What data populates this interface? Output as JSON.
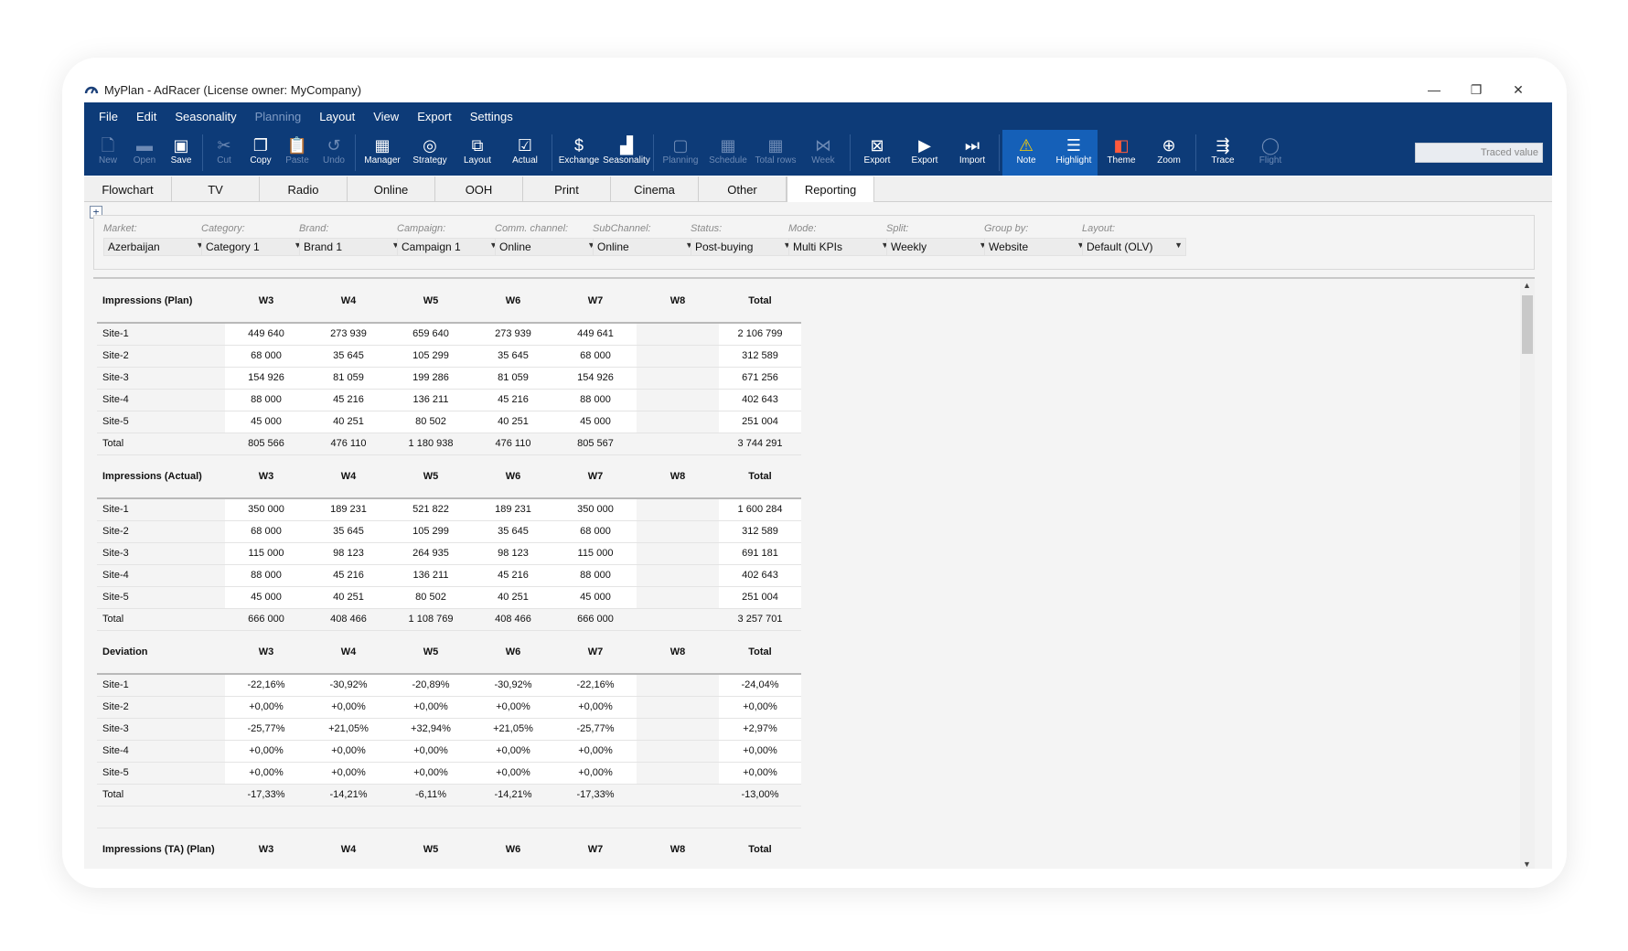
{
  "window": {
    "title": "MyPlan - AdRacer (License owner: MyCompany)"
  },
  "menu": [
    {
      "label": "File",
      "disabled": false
    },
    {
      "label": "Edit",
      "disabled": false
    },
    {
      "label": "Seasonality",
      "disabled": false
    },
    {
      "label": "Planning",
      "disabled": true
    },
    {
      "label": "Layout",
      "disabled": false
    },
    {
      "label": "View",
      "disabled": false
    },
    {
      "label": "Export",
      "disabled": false
    },
    {
      "label": "Settings",
      "disabled": false
    }
  ],
  "toolbar": [
    {
      "label": "New",
      "icon": "new-document-icon",
      "glyph": "🗋",
      "state": "dim"
    },
    {
      "label": "Open",
      "icon": "open-folder-icon",
      "glyph": "▬",
      "state": "dim"
    },
    {
      "label": "Save",
      "icon": "save-icon",
      "glyph": "▣",
      "state": ""
    },
    {
      "sep": true
    },
    {
      "label": "Cut",
      "icon": "cut-icon",
      "glyph": "✂",
      "state": "dim"
    },
    {
      "label": "Copy",
      "icon": "copy-icon",
      "glyph": "❐",
      "state": ""
    },
    {
      "label": "Paste",
      "icon": "paste-icon",
      "glyph": "📋",
      "state": "dim"
    },
    {
      "label": "Undo",
      "icon": "undo-icon",
      "glyph": "↺",
      "state": "dim"
    },
    {
      "sep": true
    },
    {
      "label": "Manager",
      "icon": "briefcase-icon",
      "glyph": "▦",
      "state": "",
      "wide": true
    },
    {
      "label": "Strategy",
      "icon": "target-icon",
      "glyph": "◎",
      "state": "",
      "wide": true
    },
    {
      "label": "Layout",
      "icon": "layout-icon",
      "glyph": "⧉",
      "state": "",
      "wide": true
    },
    {
      "label": "Actual",
      "icon": "checkbox-icon",
      "glyph": "☑",
      "state": "",
      "wide": true
    },
    {
      "sep": true
    },
    {
      "label": "Exchange",
      "icon": "dollar-icon",
      "glyph": "$",
      "state": "",
      "wide": true
    },
    {
      "label": "Seasonality",
      "icon": "chart-icon",
      "glyph": "▟",
      "state": "",
      "wide": true
    },
    {
      "sep": true
    },
    {
      "label": "Planning",
      "icon": "planning-icon",
      "glyph": "▢",
      "state": "dim",
      "wide": true
    },
    {
      "label": "Schedule",
      "icon": "schedule-icon",
      "glyph": "▦",
      "state": "dim",
      "wide": true
    },
    {
      "label": "Total rows",
      "icon": "total-rows-icon",
      "glyph": "▦",
      "state": "dim",
      "wide": true
    },
    {
      "label": "Week",
      "icon": "week-icon",
      "glyph": "⋈",
      "state": "dim",
      "wide": true
    },
    {
      "sep": true
    },
    {
      "label": "Export",
      "icon": "excel-icon",
      "glyph": "⊠",
      "state": "",
      "wide": true
    },
    {
      "label": "Export",
      "icon": "export-icon",
      "glyph": "▶",
      "state": "",
      "wide": true
    },
    {
      "label": "Import",
      "icon": "import-icon",
      "glyph": "⏭",
      "state": "",
      "wide": true
    },
    {
      "sep": true
    },
    {
      "label": "Note",
      "icon": "warning-icon",
      "glyph": "⚠",
      "state": "active",
      "wide": true
    },
    {
      "label": "Highlight",
      "icon": "highlight-icon",
      "glyph": "☰",
      "state": "active",
      "wide": true
    },
    {
      "label": "Theme",
      "icon": "theme-icon",
      "glyph": "◧",
      "state": "",
      "wide": true
    },
    {
      "label": "Zoom",
      "icon": "zoom-icon",
      "glyph": "⊕",
      "state": "",
      "wide": true
    },
    {
      "sep": true
    },
    {
      "label": "Trace",
      "icon": "trace-icon",
      "glyph": "⇶",
      "state": "",
      "wide": true
    },
    {
      "label": "Flight",
      "icon": "flight-icon",
      "glyph": "◯",
      "state": "dim",
      "wide": true
    }
  ],
  "traced_value": "Traced value",
  "tabs": [
    "Flowchart",
    "TV",
    "Radio",
    "Online",
    "OOH",
    "Print",
    "Cinema",
    "Other",
    "Reporting"
  ],
  "active_tab": "Reporting",
  "filters": [
    {
      "label": "Market:",
      "value": "Azerbaijan"
    },
    {
      "label": "Category:",
      "value": "Category 1"
    },
    {
      "label": "Brand:",
      "value": "Brand 1"
    },
    {
      "label": "Campaign:",
      "value": "Campaign 1"
    },
    {
      "label": "Comm. channel:",
      "value": "Online"
    },
    {
      "label": "SubChannel:",
      "value": "Online"
    },
    {
      "label": "Status:",
      "value": "Post-buying"
    },
    {
      "label": "Mode:",
      "value": "Multi KPIs"
    },
    {
      "label": "Split:",
      "value": "Weekly"
    },
    {
      "label": "Group by:",
      "value": "Website"
    },
    {
      "label": "Layout:",
      "value": "Default (OLV)"
    }
  ],
  "columns": [
    "W3",
    "W4",
    "W5",
    "W6",
    "W7",
    "W8",
    "Total"
  ],
  "sections": [
    {
      "title": "Impressions (Plan)",
      "rows": [
        {
          "name": "Site-1",
          "values": [
            "449 640",
            "273 939",
            "659 640",
            "273 939",
            "449 641",
            "",
            "2 106 799"
          ]
        },
        {
          "name": "Site-2",
          "values": [
            "68 000",
            "35 645",
            "105 299",
            "35 645",
            "68 000",
            "",
            "312 589"
          ]
        },
        {
          "name": "Site-3",
          "values": [
            "154 926",
            "81 059",
            "199 286",
            "81 059",
            "154 926",
            "",
            "671 256"
          ]
        },
        {
          "name": "Site-4",
          "values": [
            "88 000",
            "45 216",
            "136 211",
            "45 216",
            "88 000",
            "",
            "402 643"
          ]
        },
        {
          "name": "Site-5",
          "values": [
            "45 000",
            "40 251",
            "80 502",
            "40 251",
            "45 000",
            "",
            "251 004"
          ]
        },
        {
          "name": "Total",
          "values": [
            "805 566",
            "476 110",
            "1 180 938",
            "476 110",
            "805 567",
            "",
            "3 744 291"
          ]
        }
      ]
    },
    {
      "title": "Impressions (Actual)",
      "rows": [
        {
          "name": "Site-1",
          "values": [
            "350 000",
            "189 231",
            "521 822",
            "189 231",
            "350 000",
            "",
            "1 600 284"
          ]
        },
        {
          "name": "Site-2",
          "values": [
            "68 000",
            "35 645",
            "105 299",
            "35 645",
            "68 000",
            "",
            "312 589"
          ]
        },
        {
          "name": "Site-3",
          "values": [
            "115 000",
            "98 123",
            "264 935",
            "98 123",
            "115 000",
            "",
            "691 181"
          ]
        },
        {
          "name": "Site-4",
          "values": [
            "88 000",
            "45 216",
            "136 211",
            "45 216",
            "88 000",
            "",
            "402 643"
          ]
        },
        {
          "name": "Site-5",
          "values": [
            "45 000",
            "40 251",
            "80 502",
            "40 251",
            "45 000",
            "",
            "251 004"
          ]
        },
        {
          "name": "Total",
          "values": [
            "666 000",
            "408 466",
            "1 108 769",
            "408 466",
            "666 000",
            "",
            "3 257 701"
          ]
        }
      ]
    },
    {
      "title": "Deviation",
      "rows": [
        {
          "name": "Site-1",
          "values": [
            "-22,16%",
            "-30,92%",
            "-20,89%",
            "-30,92%",
            "-22,16%",
            "",
            "-24,04%"
          ]
        },
        {
          "name": "Site-2",
          "values": [
            "+0,00%",
            "+0,00%",
            "+0,00%",
            "+0,00%",
            "+0,00%",
            "",
            "+0,00%"
          ]
        },
        {
          "name": "Site-3",
          "values": [
            "-25,77%",
            "+21,05%",
            "+32,94%",
            "+21,05%",
            "-25,77%",
            "",
            "+2,97%"
          ]
        },
        {
          "name": "Site-4",
          "values": [
            "+0,00%",
            "+0,00%",
            "+0,00%",
            "+0,00%",
            "+0,00%",
            "",
            "+0,00%"
          ]
        },
        {
          "name": "Site-5",
          "values": [
            "+0,00%",
            "+0,00%",
            "+0,00%",
            "+0,00%",
            "+0,00%",
            "",
            "+0,00%"
          ]
        },
        {
          "name": "Total",
          "values": [
            "-17,33%",
            "-14,21%",
            "-6,11%",
            "-14,21%",
            "-17,33%",
            "",
            "-13,00%"
          ]
        }
      ]
    },
    {
      "title": "Impressions (TA) (Plan)",
      "rows": []
    }
  ]
}
